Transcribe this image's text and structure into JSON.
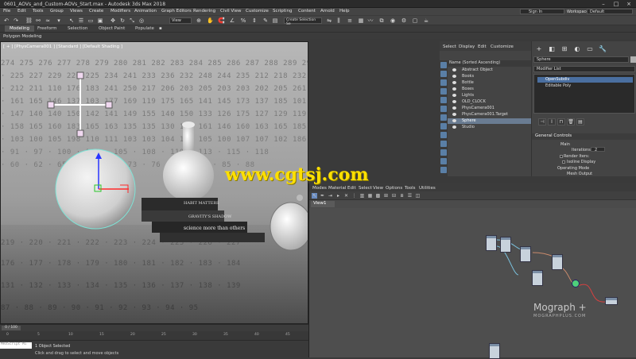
{
  "window": {
    "title": "0601_AOVs_and_Custom-AOVs_Start.max - Autodesk 3ds Max 2018"
  },
  "menubar": {
    "items": [
      "File",
      "Edit",
      "Tools",
      "Group",
      "Views",
      "Create",
      "Modifiers",
      "Animation",
      "Graph Editors",
      "Rendering",
      "Civil View",
      "Customize",
      "Scripting",
      "Content",
      "Arnold",
      "Help"
    ],
    "sign_in": "Sign In",
    "workspaces_label": "Workspaces:",
    "workspace_value": "Default"
  },
  "toolbar": {
    "view_dropdown": "View",
    "selection_set": "Create Selection Se"
  },
  "ribbon": {
    "tabs": [
      "Modeling",
      "Freeform",
      "Selection",
      "Object Paint",
      "Populate"
    ],
    "panel": "Polygon Modeling"
  },
  "viewport": {
    "label": "[ + ] [PhysCamera001 ] [Standard ] [Default Shading ]"
  },
  "scene_explorer": {
    "menu": [
      "Select",
      "Display",
      "Edit",
      "Customize"
    ],
    "header": "Name (Sorted Ascending)",
    "items": [
      {
        "label": "Abstract Object",
        "selected": false
      },
      {
        "label": "Books",
        "selected": false
      },
      {
        "label": "Bottle",
        "selected": false
      },
      {
        "label": "Boxes",
        "selected": false
      },
      {
        "label": "Lights",
        "selected": false
      },
      {
        "label": "OLD_CLOCK",
        "selected": false
      },
      {
        "label": "PhysCamera001",
        "selected": false
      },
      {
        "label": "PhysCamera001.Target",
        "selected": false
      },
      {
        "label": "Sphere",
        "selected": true
      },
      {
        "label": "Studio",
        "selected": false
      }
    ]
  },
  "command_panel": {
    "object_name": "Sphere",
    "modifier_list": "Modifier List",
    "modifier_stack": [
      {
        "label": "OpenSubdiv",
        "selected": true
      },
      {
        "label": "Editable Poly",
        "selected": false
      }
    ],
    "general_controls": "General Controls",
    "main_label": "Main",
    "iterations_label": "Iterations:",
    "iterations_value": "2",
    "render_iters_label": "Render Iters:",
    "isoline_label": "Isoline Display",
    "operating_mode_label": "Operating Mode",
    "mesh_output_label": "Mesh Output"
  },
  "slate": {
    "menu": [
      "Modes",
      "Material",
      "Edit",
      "Select",
      "View",
      "Options",
      "Tools",
      "Utilities"
    ],
    "view_tab": "View1",
    "brand": "Mograph +",
    "brand_sub": "MOGRAPHPLUS.COM"
  },
  "timeline": {
    "slider_label": "0 / 100",
    "ticks": [
      "0",
      "5",
      "10",
      "15",
      "20",
      "25",
      "30",
      "35",
      "40",
      "45"
    ]
  },
  "status": {
    "maxscript": "MAXScript Mi",
    "line1": "1 Object Selected",
    "line2": "Click and drag to select and move objects"
  },
  "watermark": "www.cgtsj.com"
}
